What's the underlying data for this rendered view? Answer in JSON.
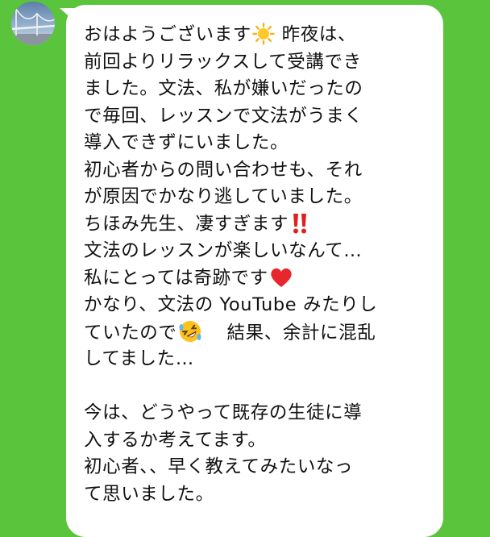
{
  "chat": {
    "contact_avatar_icon": "bridge-photo-avatar",
    "bubble_color": "#ffffff",
    "background_color": "#5ac43c",
    "message": {
      "line_01_a": "おはようございます",
      "sun_emoji": "sun-emoji",
      "line_01_b": "昨夜は、",
      "line_02": "前回よりリラックスして受講でき",
      "line_03": "ました。文法、私が嫌いだったの",
      "line_04": "で毎回、レッスンで文法がうまく",
      "line_05": "導入できずにいました。",
      "line_06": "初心者からの問い合わせも、それ",
      "line_07": "が原因でかなり逃していました。",
      "line_08": "ちほみ先生、凄すぎます",
      "double_exclamation_emoji": "double-exclamation-emoji",
      "line_09": "文法のレッスンが楽しいなんて…",
      "line_10": "私にとっては奇跡です",
      "heart_emoji": "red-heart-emoji",
      "line_11": "かなり、文法の YouTube みたりし",
      "line_12_a": "ていたので",
      "rofl_emoji": "rolling-on-floor-laughing-emoji",
      "line_12_b": "結果、余計に混乱",
      "line_13": "してました…",
      "line_15": "今は、どうやって既存の生徒に導",
      "line_16": "入するか考えてます。",
      "line_17": "初心者、、早く教えてみたいなっ",
      "line_18": "て思いました。"
    }
  }
}
